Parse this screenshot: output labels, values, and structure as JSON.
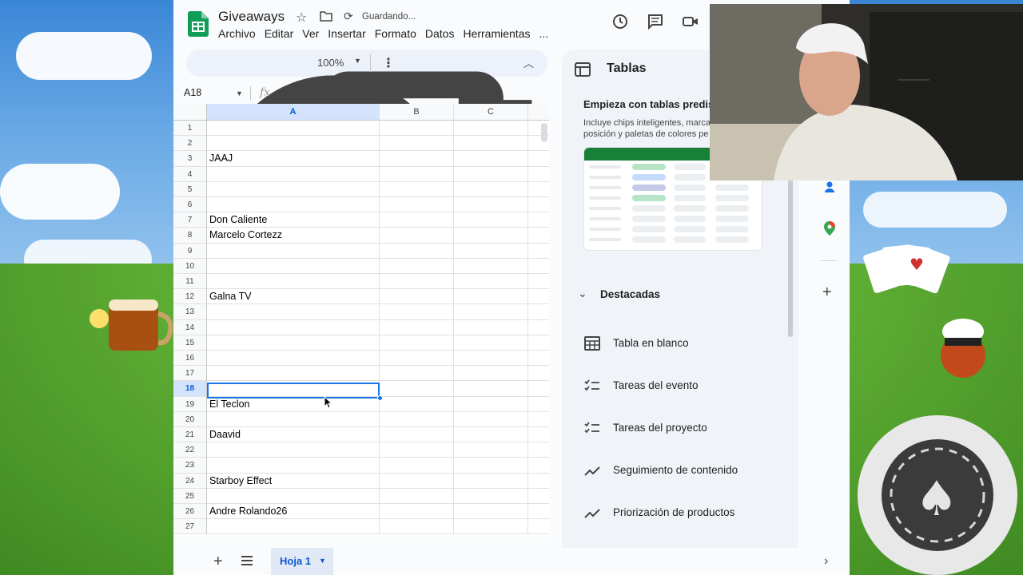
{
  "document": {
    "title": "Giveaways",
    "status": "Guardando..."
  },
  "menu": [
    "Archivo",
    "Editar",
    "Ver",
    "Insertar",
    "Formato",
    "Datos",
    "Herramientas",
    "..."
  ],
  "toolbar": {
    "zoom": "100%"
  },
  "formula_bar": {
    "cell_ref": "A18",
    "fx_label": "fx"
  },
  "grid": {
    "columns": [
      "A",
      "B",
      "C"
    ],
    "selected_column": "A",
    "selected_row": "18",
    "rows": [
      {
        "num": "1",
        "a": ""
      },
      {
        "num": "2",
        "a": ""
      },
      {
        "num": "3",
        "a": "JAAJ"
      },
      {
        "num": "4",
        "a": ""
      },
      {
        "num": "5",
        "a": ""
      },
      {
        "num": "6",
        "a": ""
      },
      {
        "num": "7",
        "a": "Don Caliente"
      },
      {
        "num": "8",
        "a": "Marcelo Cortezz"
      },
      {
        "num": "9",
        "a": ""
      },
      {
        "num": "10",
        "a": ""
      },
      {
        "num": "11",
        "a": ""
      },
      {
        "num": "12",
        "a": "Galna TV"
      },
      {
        "num": "13",
        "a": ""
      },
      {
        "num": "14",
        "a": ""
      },
      {
        "num": "15",
        "a": ""
      },
      {
        "num": "16",
        "a": ""
      },
      {
        "num": "17",
        "a": ""
      },
      {
        "num": "18",
        "a": ""
      },
      {
        "num": "19",
        "a": "El Teclon"
      },
      {
        "num": "20",
        "a": ""
      },
      {
        "num": "21",
        "a": "Daavid"
      },
      {
        "num": "22",
        "a": ""
      },
      {
        "num": "23",
        "a": ""
      },
      {
        "num": "24",
        "a": "Starboy Effect"
      },
      {
        "num": "25",
        "a": ""
      },
      {
        "num": "26",
        "a": "Andre Rolando26"
      },
      {
        "num": "27",
        "a": ""
      }
    ]
  },
  "sheet_tabs": {
    "active": "Hoja 1"
  },
  "side_panel": {
    "title": "Tablas",
    "subtitle": "Empieza con tablas predis",
    "description_line1": "Incluye chips inteligentes, marca",
    "description_line2": "posición y paletas de colores pe",
    "section": "Destacadas",
    "templates": [
      {
        "label": "Tabla en blanco",
        "icon": "table-icon"
      },
      {
        "label": "Tareas del evento",
        "icon": "checklist-icon"
      },
      {
        "label": "Tareas del proyecto",
        "icon": "checklist-icon"
      },
      {
        "label": "Seguimiento de contenido",
        "icon": "trend-icon"
      },
      {
        "label": "Priorización de productos",
        "icon": "trend-icon"
      }
    ]
  },
  "colors": {
    "accent": "#1a73e8",
    "sheets_green": "#188038",
    "selected_header": "#d3e3fd"
  }
}
